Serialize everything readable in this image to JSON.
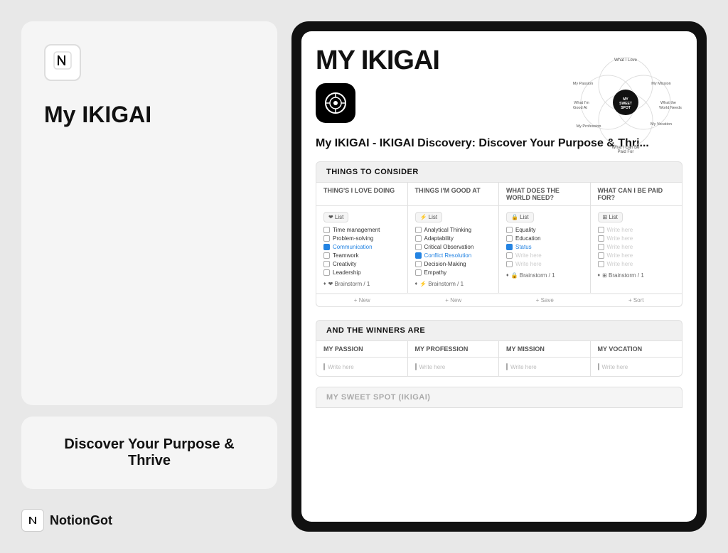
{
  "left": {
    "notion_icon": "N",
    "title": "My IKIGAI",
    "subtitle": "Discover Your Purpose & Thrive",
    "brand": {
      "icon": "N",
      "name": "NotionGot"
    }
  },
  "right": {
    "page_title": "MY IKIGAI",
    "doc_title": "My IKIGAI - IKIGAI  Discovery: Discover Your Purpose & Thri...",
    "sections": {
      "things_to_consider": "THINGS TO CONSIDER",
      "and_the_winners_are": "AND THE WINNERS ARE",
      "sweet_spot": "MY SWEET SPOT (IKIGAI)"
    },
    "columns": {
      "things_love": "THING'S I LOVE DOING",
      "things_good": "THINGS I'M GOOD AT",
      "world_needs": "WHAT DOES THE WORLD NEED?",
      "paid_for": "WHAT CAN I BE PAID FOR?"
    },
    "col_types": {
      "love": "❤ List",
      "good": "⚡ List",
      "need": "🔒 List",
      "paid": "⊞ List"
    },
    "love_items": [
      "Time management",
      "Problem-solving",
      "Communication",
      "Teamwork",
      "Creativity",
      "Leadership"
    ],
    "good_items": [
      "Analytical Thinking",
      "Adaptability",
      "Critical Observation",
      "Conflict Resolution",
      "Decision-Making",
      "Empathy"
    ],
    "need_items": [
      "Equality",
      "Education",
      "Status",
      "Write here",
      "Write here"
    ],
    "paid_items": [
      "Write here",
      "Write here",
      "Write here",
      "Write here",
      "Write here"
    ],
    "brainstorm": "Brainstorm / 1",
    "view_labels": [
      "+ New",
      "+ New",
      "+ Save",
      "+ Sort"
    ],
    "winners": {
      "passion": "MY PASSION",
      "profession": "MY PROFESSION",
      "mission": "MY MISSION",
      "vocation": "MY VOCATION"
    },
    "write_here": "Write here"
  },
  "venn": {
    "labels": [
      "What I Love",
      "My Passion",
      "My Mission",
      "What I'm Good At",
      "MY SWEET SPOT",
      "What the World Needs",
      "My Profession",
      "My Vocation",
      "What I Can Be Paid For"
    ]
  }
}
